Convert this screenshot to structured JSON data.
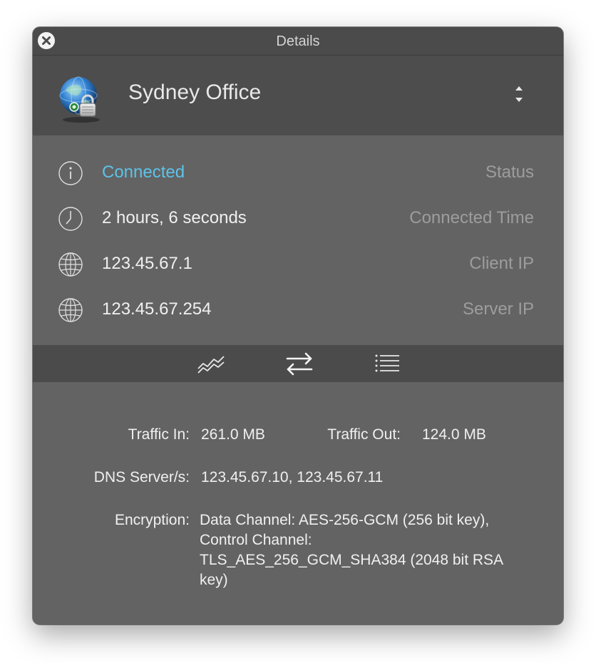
{
  "window": {
    "title": "Details"
  },
  "header": {
    "profile_name": "Sydney Office"
  },
  "info": {
    "status": {
      "value": "Connected",
      "label": "Status"
    },
    "connected_time": {
      "value": "2 hours, 6 seconds",
      "label": "Connected Time"
    },
    "client_ip": {
      "value": "123.45.67.1",
      "label": "Client IP"
    },
    "server_ip": {
      "value": "123.45.67.254",
      "label": "Server IP"
    }
  },
  "toolbar": {
    "buttons": [
      {
        "icon": "graph-icon"
      },
      {
        "icon": "transfer-arrows-icon"
      },
      {
        "icon": "list-icon"
      }
    ]
  },
  "details": {
    "traffic_in_label": "Traffic In:",
    "traffic_in_value": "261.0 MB",
    "traffic_out_label": "Traffic Out:",
    "traffic_out_value": "124.0 MB",
    "dns_label": "DNS Server/s:",
    "dns_value": "123.45.67.10, 123.45.67.11",
    "encryption_label": "Encryption:",
    "encryption_value": "Data Channel: AES-256-GCM (256 bit key), Control Channel: TLS_AES_256_GCM_SHA384 (2048 bit RSA key)"
  },
  "colors": {
    "accent": "#5cc3e8",
    "panel_dark": "#4b4b4b",
    "panel": "#636363"
  }
}
